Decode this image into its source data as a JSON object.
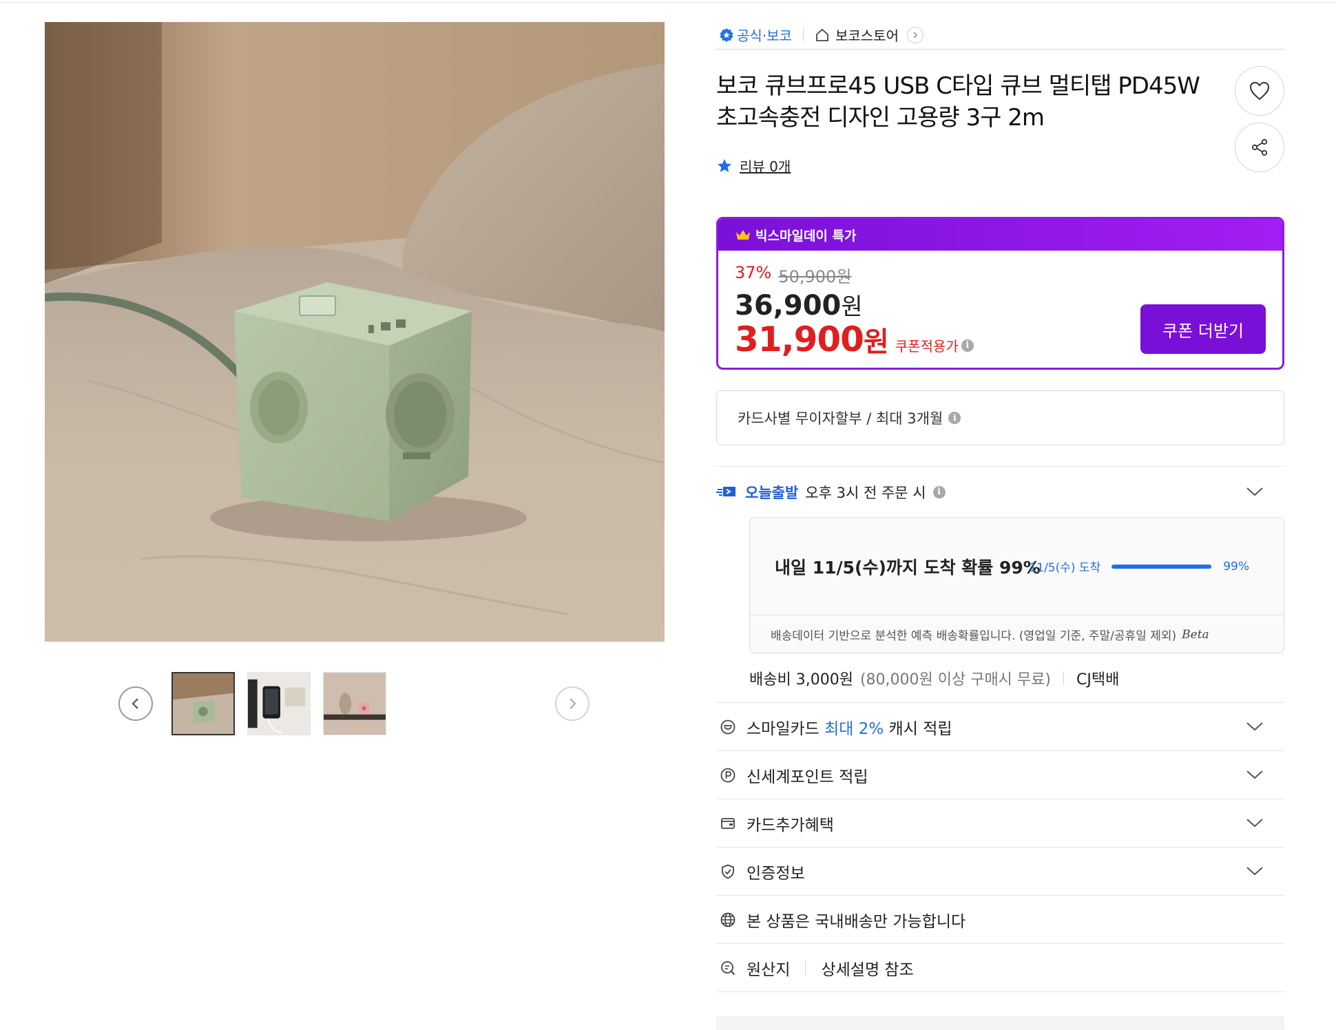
{
  "brand": {
    "official_label": "공식·보코",
    "store_label": "보코스토어"
  },
  "product": {
    "title": "보코 큐브프로45 USB C타입 큐브 멀티탭 PD45W 초고속충전 디자인 고용량 3구 2m",
    "review_label": "리뷰 0개"
  },
  "price": {
    "event_label": "빅스마일데이 특가",
    "discount_rate": "37%",
    "original_price": "50,900원",
    "sale_price": "36,900",
    "coupon_price": "31,900",
    "won": "원",
    "coupon_price_label": "쿠폰적용가",
    "coupon_button": "쿠폰 더받기"
  },
  "installment": {
    "text": "카드사별 무이자할부 / 최대 3개월"
  },
  "shipping": {
    "today_label": "오늘출발",
    "cutoff": "오후 3시 전 주문 시",
    "predict_title": "내일 11/5(수)까지 도착 확률 99%",
    "predict_date": "11/5(수) 도착",
    "predict_percent": "99%",
    "predict_fraction": 0.99,
    "predict_note": "배송데이터 기반으로 분석한 예측 배송확률입니다. (영업일 기준, 주말/공휴일 제외)",
    "beta": "Beta",
    "fee_label": "배송비 3,000원",
    "fee_condition": "(80,000원 이상 구매시 무료)",
    "carrier": "CJ택배"
  },
  "benefits": [
    {
      "pre": "스마일카드 ",
      "highlight": "최대 2%",
      "post": " 캐시 적립",
      "icon": "smile-card-icon"
    },
    {
      "pre": "신세계포인트 적립",
      "highlight": "",
      "post": "",
      "icon": "point-icon"
    },
    {
      "pre": "카드추가혜택",
      "highlight": "",
      "post": "",
      "icon": "card-icon"
    },
    {
      "pre": "인증정보",
      "highlight": "",
      "post": "",
      "icon": "shield-check-icon"
    },
    {
      "pre": "본 상품은 국내배송만 가능합니다",
      "highlight": "",
      "post": "",
      "icon": "globe-icon"
    }
  ],
  "origin": {
    "label": "원산지",
    "value": "상세설명 참조"
  },
  "colors": {
    "accent_purple": "#7a10d8",
    "sale_red": "#e01e1e",
    "link_blue": "#1f6fe5"
  }
}
